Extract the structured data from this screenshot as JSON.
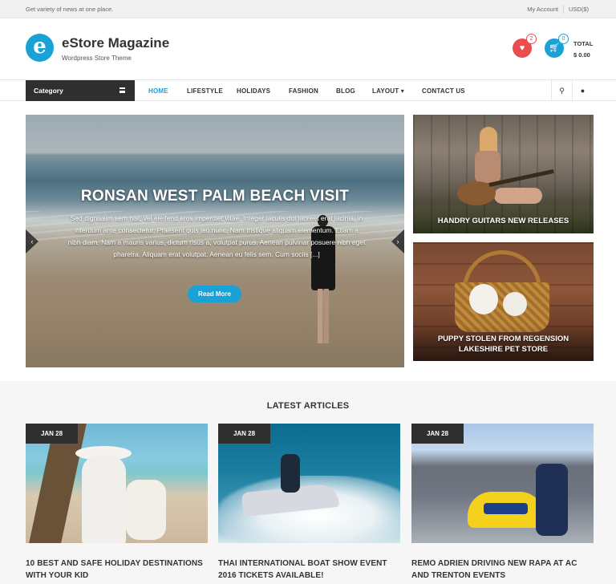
{
  "topbar": {
    "tagline": "Get variety of news at one place.",
    "account_label": "My Account",
    "currency": "USD($)"
  },
  "header": {
    "logo_letter": "e",
    "site_title": "eStore Magazine",
    "site_description": "Wordpress Store Theme",
    "wishlist_count": "2",
    "cart_count": "0",
    "total_label": "TOTAL",
    "total_value": "$ 0.00",
    "accent_color": "#1aa1d6",
    "wishlist_color": "#e84e4e"
  },
  "nav": {
    "category_label": "Category",
    "items": [
      {
        "label": "HOME"
      },
      {
        "label": "LIFESTYLE"
      },
      {
        "label": "HOLIDAYS"
      },
      {
        "label": "FASHION"
      },
      {
        "label": "BLOG"
      },
      {
        "label": "LAYOUT"
      },
      {
        "label": "CONTACT US"
      }
    ],
    "active": "HOME"
  },
  "slider": {
    "title": "RONSAN WEST PALM BEACH VISIT",
    "excerpt": "Sed dignissim sem nisl, vel eleifend eros imperdiet vitae. Integer iaculis dui laoreet erat lacinia, in interdum ante consectetur. Praesent quis leo nunc. Nam tristique aliquam elementum. Etiam a nibh diam. Nam a mauris varius, dictum risus a, volutpat purus. Aenean pulvinar posuere nibh eget pharetra. Aliquam erat volutpat. Aenean eu felis sem. Cum sociis [...]",
    "button_label": "Read More"
  },
  "side_posts": [
    {
      "title": "HANDRY GUITARS NEW RELEASES"
    },
    {
      "title": "PUPPY STOLEN FROM REGENSION LAKESHIRE PET STORE"
    }
  ],
  "latest": {
    "heading": "LATEST ARTICLES",
    "articles": [
      {
        "date": "JAN 28",
        "title": "10 BEST AND SAFE HOLIDAY DESTINATIONS WITH YOUR KID"
      },
      {
        "date": "JAN 28",
        "title": "THAI INTERNATIONAL BOAT SHOW EVENT 2016 TICKETS AVAILABLE!"
      },
      {
        "date": "JAN 28",
        "title": "REMO ADRIEN DRIVING NEW RAPA AT AC AND TRENTON EVENTS"
      }
    ]
  }
}
